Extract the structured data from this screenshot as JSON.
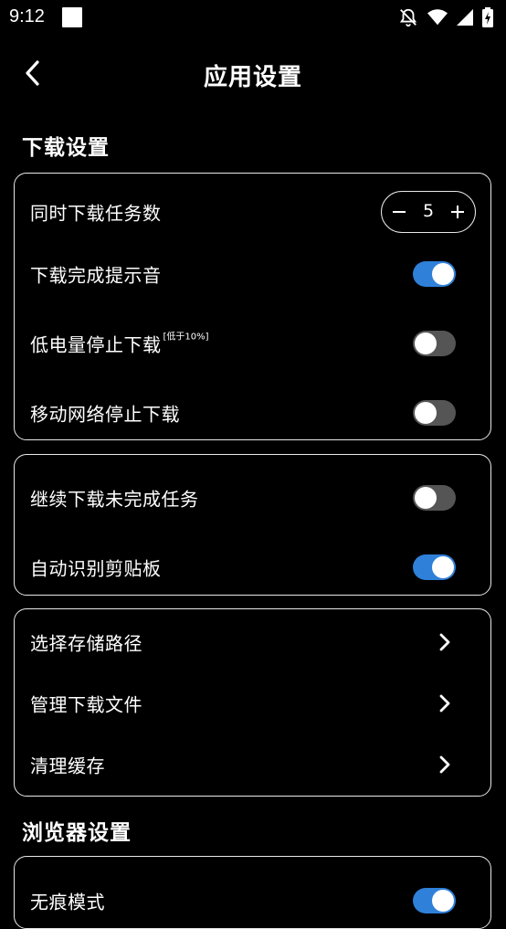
{
  "status_bar": {
    "time": "9:12",
    "icons": [
      "notifications-off-icon",
      "wifi-icon",
      "signal-icon",
      "battery-charging-icon"
    ]
  },
  "header": {
    "title": "应用设置",
    "back_icon": "back-arrow-icon"
  },
  "sections": {
    "download_title": "下载设置",
    "browser_title": "浏览器设置"
  },
  "download_card": {
    "concurrent_label": "同时下载任务数",
    "concurrent_value": "5",
    "complete_sound_label": "下载完成提示音",
    "complete_sound_on": true,
    "low_battery_label": "低电量停止下载",
    "low_battery_note": "[低于10%]",
    "low_battery_on": false,
    "mobile_network_label": "移动网络停止下载",
    "mobile_network_on": false
  },
  "resume_card": {
    "resume_label": "继续下载未完成任务",
    "resume_on": false,
    "clipboard_label": "自动识别剪贴板",
    "clipboard_on": true
  },
  "file_card": {
    "storage_path_label": "选择存储路径",
    "manage_files_label": "管理下载文件",
    "clear_cache_label": "清理缓存"
  },
  "browser_card": {
    "first_item_label": "无痕模式",
    "first_item_on": true
  },
  "colors": {
    "background": "#000000",
    "text": "#ffffff",
    "toggle_on": "#2f80d8",
    "toggle_off": "#555555",
    "card_border": "#e8e8e8"
  }
}
